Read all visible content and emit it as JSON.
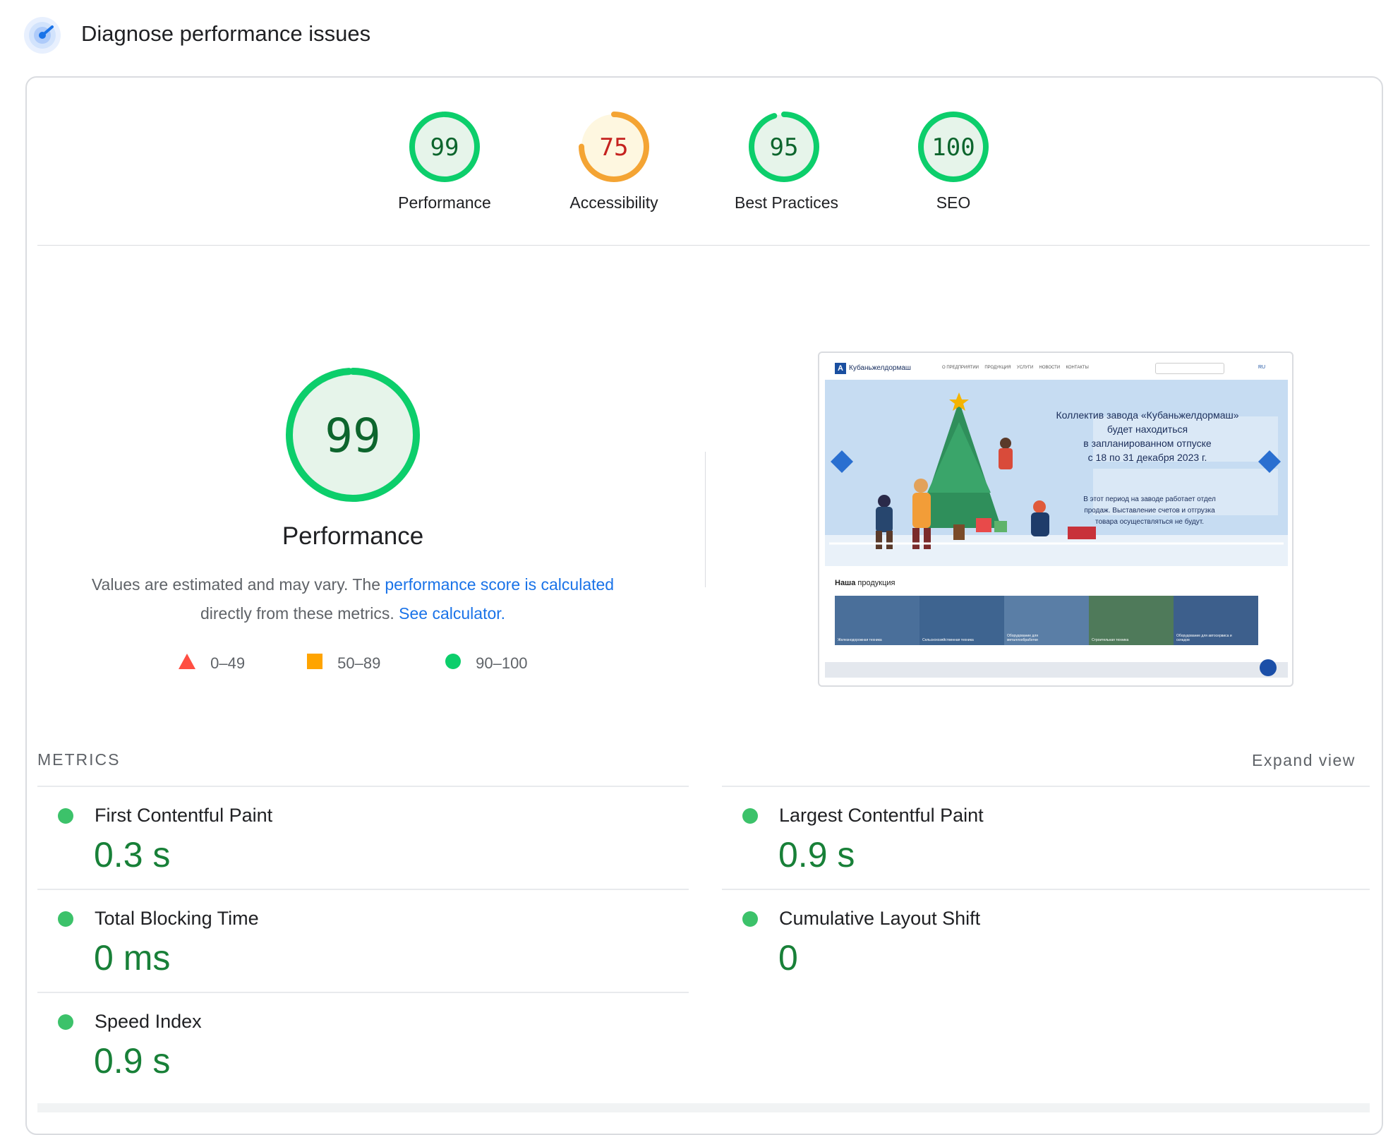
{
  "header": {
    "title": "Diagnose performance issues",
    "icon": "lighthouse-gauge-icon"
  },
  "scores": [
    {
      "label": "Performance",
      "value": "99",
      "score": 99,
      "color": "#0cce6b",
      "text_color": "#0d652d",
      "fill": "#e6f4ea"
    },
    {
      "label": "Accessibility",
      "value": "75",
      "score": 75,
      "color": "#f4a433",
      "text_color": "#c5221f",
      "fill": "#fef7e0"
    },
    {
      "label": "Best Practices",
      "value": "95",
      "score": 95,
      "color": "#0cce6b",
      "text_color": "#0d652d",
      "fill": "#e6f4ea"
    },
    {
      "label": "SEO",
      "value": "100",
      "score": 100,
      "color": "#0cce6b",
      "text_color": "#0d652d",
      "fill": "#e6f4ea"
    }
  ],
  "main": {
    "score": "99",
    "score_value": 99,
    "title": "Performance",
    "description_prefix": "Values are estimated and may vary. The ",
    "link_score": "performance score is calculated",
    "description_middle": "directly from these metrics. ",
    "link_calculator": "See calculator."
  },
  "legend": [
    {
      "range": "0–49",
      "shape": "triangle",
      "color": "#ff4e42"
    },
    {
      "range": "50–89",
      "shape": "square",
      "color": "#ffa400"
    },
    {
      "range": "90–100",
      "shape": "circle",
      "color": "#0cce6b"
    }
  ],
  "thumbnail": {
    "brand": "Кубаньжелдормаш",
    "nav": [
      "О ПРЕДПРИЯТИИ",
      "ПРОДУКЦИЯ",
      "УСЛУГИ",
      "НОВОСТИ",
      "КОНТАКТЫ"
    ],
    "lang": "RU",
    "banner_lines": [
      "Коллектив завода «Кубаньжелдормаш»",
      "будет находиться",
      "в запланированном отпуске",
      "с 18 по 31 декабря 2023 г."
    ],
    "banner_sub": [
      "В этот период на заводе работает отдел",
      "продаж. Выставление счетов и отгрузка",
      "товара осуществляться не будут."
    ],
    "section_bold": "Наша",
    "section_rest": " продукция",
    "products": [
      "Железнодорожная техника",
      "Сельскохозяйственная техника",
      "Оборудование для металлообработки",
      "Строительная техника",
      "Оборудование для автосервиса и складов"
    ]
  },
  "metrics": {
    "title": "METRICS",
    "expand": "Expand view",
    "items": [
      {
        "label": "First Contentful Paint",
        "value": "0.3 s"
      },
      {
        "label": "Largest Contentful Paint",
        "value": "0.9 s"
      },
      {
        "label": "Total Blocking Time",
        "value": "0 ms"
      },
      {
        "label": "Cumulative Layout Shift",
        "value": "0"
      },
      {
        "label": "Speed Index",
        "value": "0.9 s"
      }
    ]
  }
}
